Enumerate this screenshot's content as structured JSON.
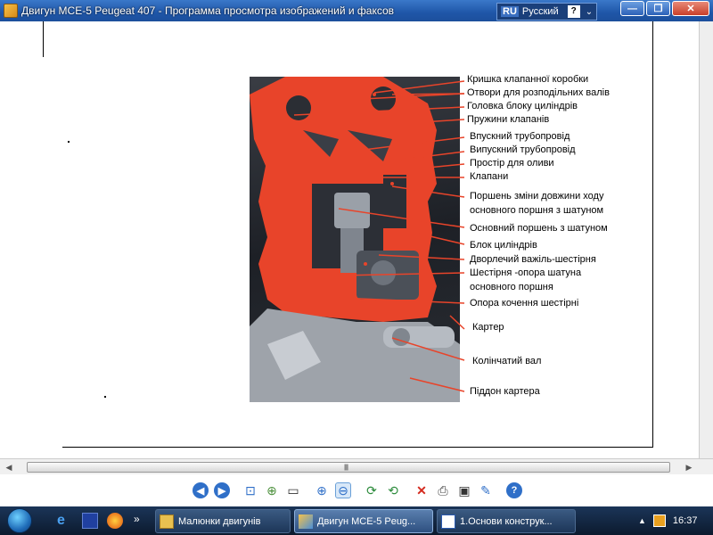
{
  "window": {
    "title": "Двигун MCE-5 Peugeat 407 - Программа просмотра изображений и факсов",
    "lang_code": "RU",
    "lang_name": "Русский",
    "help": "?",
    "lang_menu": "⌄",
    "minimize": "—",
    "maximize": "❐",
    "close": "✕"
  },
  "figure": {
    "labels": [
      "Кришка клапанної коробки",
      "Отвори для розподільних валів",
      "Головка блоку циліндрів",
      "Пружини клапанів",
      "Впускний трубопровід",
      "Випускний трубопровід",
      "Простір для оливи",
      "Клапани",
      "Поршень зміни довжини ходу",
      "основного поршня з шатуном",
      "Основний поршень з шатуном",
      "Блок циліндрів",
      "Дворлечий важіль-шестірня",
      "Шестірня  -опора шатуна",
      "основного поршня",
      "Опора кочення  шестірні",
      "Картер",
      "Колінчатий вал",
      "Піддон картера"
    ]
  },
  "scrollbar": {
    "left": "◀",
    "right": "▶",
    "grip": "|||||"
  },
  "toolbar": {
    "buttons": [
      {
        "name": "previous-image-button",
        "glyph": "◀"
      },
      {
        "name": "next-image-button",
        "glyph": "▶"
      },
      {
        "name": "best-fit-button",
        "glyph": "⊡"
      },
      {
        "name": "actual-size-button",
        "glyph": "⊕"
      },
      {
        "name": "slideshow-button",
        "glyph": "▭"
      },
      {
        "name": "zoom-in-button",
        "glyph": "⊕"
      },
      {
        "name": "zoom-out-button",
        "glyph": "⊖"
      },
      {
        "name": "rotate-clockwise-button",
        "glyph": "⟳"
      },
      {
        "name": "rotate-counterclockwise-button",
        "glyph": "⟲"
      },
      {
        "name": "delete-button",
        "glyph": "✕"
      },
      {
        "name": "print-button",
        "glyph": "⎙"
      },
      {
        "name": "save-button",
        "glyph": "▣"
      },
      {
        "name": "edit-button",
        "glyph": "✎"
      },
      {
        "name": "help-button",
        "glyph": "?"
      }
    ]
  },
  "taskbar": {
    "overflow": "»",
    "tasks": [
      "Малюнки двигунів",
      "Двигун MCE-5 Peug...",
      "1.Основи конструк..."
    ],
    "tray_arrow": "▲",
    "clock": "16:37"
  },
  "colors": {
    "titlebar": "#1f56a8",
    "taskbar": "#12263f",
    "cutaway_red": "#e8442a"
  }
}
